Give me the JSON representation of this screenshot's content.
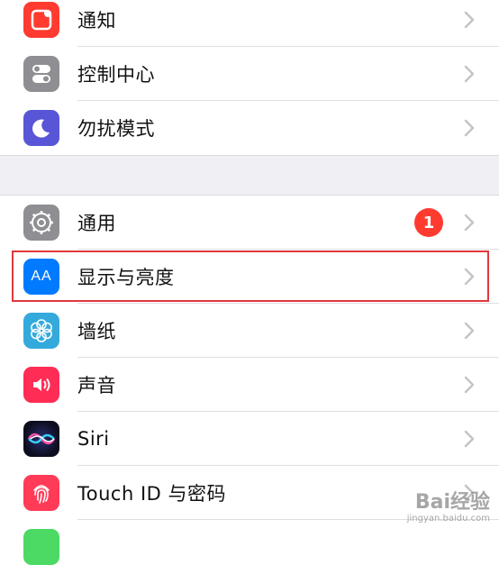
{
  "colors": {
    "background": "#efeff4",
    "highlight_border": "#e0393c",
    "badge": "#ff3b30"
  },
  "group1": {
    "items": [
      {
        "label": "通知",
        "icon": "notifications-icon",
        "icon_color": "#ff3b30"
      },
      {
        "label": "控制中心",
        "icon": "control-center-icon",
        "icon_color": "#8e8e93"
      },
      {
        "label": "勿扰模式",
        "icon": "moon-icon",
        "icon_color": "#5856d6"
      }
    ]
  },
  "group2": {
    "items": [
      {
        "label": "通用",
        "icon": "gear-icon",
        "icon_color": "#8e8e93",
        "badge": "1"
      },
      {
        "label": "显示与亮度",
        "icon": "display-brightness-icon",
        "icon_color": "#007aff",
        "icon_text": "AA",
        "highlighted": true
      },
      {
        "label": "墙纸",
        "icon": "flower-icon",
        "icon_color": "#34aadc"
      },
      {
        "label": "声音",
        "icon": "speaker-icon",
        "icon_color": "#ff2d55"
      },
      {
        "label": "Siri",
        "icon": "siri-icon",
        "icon_color": "#1c1c3a"
      },
      {
        "label": "Touch ID 与密码",
        "icon": "fingerprint-icon",
        "icon_color": "#ff3b58"
      }
    ]
  },
  "watermark": {
    "main": "Bai经验",
    "sub": "jingyan.baidu.com"
  }
}
